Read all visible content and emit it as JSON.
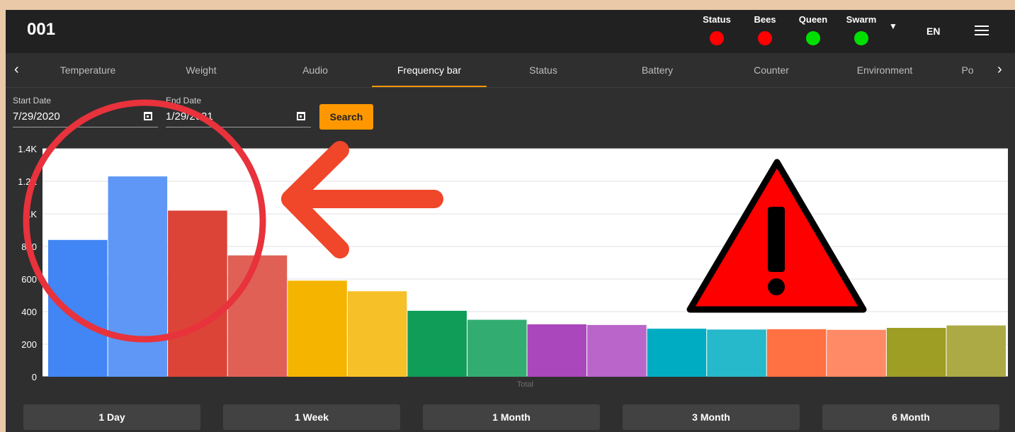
{
  "device": {
    "id": "001"
  },
  "status_indicators": [
    {
      "label": "Status",
      "color": "#ff0000"
    },
    {
      "label": "Bees",
      "color": "#ff0000"
    },
    {
      "label": "Queen",
      "color": "#00e000"
    },
    {
      "label": "Swarm",
      "color": "#00e000"
    }
  ],
  "header": {
    "language": "EN",
    "menu_icon": "hamburger-icon",
    "dropdown_icon": "caret-down-icon"
  },
  "tabs": [
    {
      "label": "Temperature",
      "active": false
    },
    {
      "label": "Weight",
      "active": false
    },
    {
      "label": "Audio",
      "active": false
    },
    {
      "label": "Frequency bar",
      "active": true
    },
    {
      "label": "Status",
      "active": false
    },
    {
      "label": "Battery",
      "active": false
    },
    {
      "label": "Counter",
      "active": false
    },
    {
      "label": "Environment",
      "active": false
    },
    {
      "label": "Po",
      "active": false
    }
  ],
  "filters": {
    "start_label": "Start Date",
    "start_value": "7/29/2020",
    "end_label": "End Date",
    "end_value": "1/29/2021",
    "search_label": "Search"
  },
  "chart_data": {
    "type": "bar",
    "xlabel": "Total",
    "ylim": [
      0,
      1400
    ],
    "yticks": [
      "0",
      "200",
      "400",
      "600",
      "800",
      "1K",
      "1.2K",
      "1.4K"
    ],
    "grid": true,
    "values": [
      840,
      1230,
      1020,
      745,
      590,
      525,
      405,
      350,
      322,
      318,
      295,
      290,
      292,
      288,
      300,
      315
    ],
    "colors": [
      "#4285f4",
      "#5e97f6",
      "#db4437",
      "#e06055",
      "#f4b400",
      "#f6c028",
      "#0f9d58",
      "#33ac71",
      "#ab47bc",
      "#b965c9",
      "#00acc1",
      "#26b8cb",
      "#ff7043",
      "#ff8a65",
      "#9e9d24",
      "#abaa45"
    ]
  },
  "ranges": [
    "1 Day",
    "1 Week",
    "1 Month",
    "3 Month",
    "6 Month"
  ],
  "annotations": {
    "arrow_color": "#f0462a",
    "circle_color": "#e8323c",
    "warning_color": "#ff0000"
  }
}
